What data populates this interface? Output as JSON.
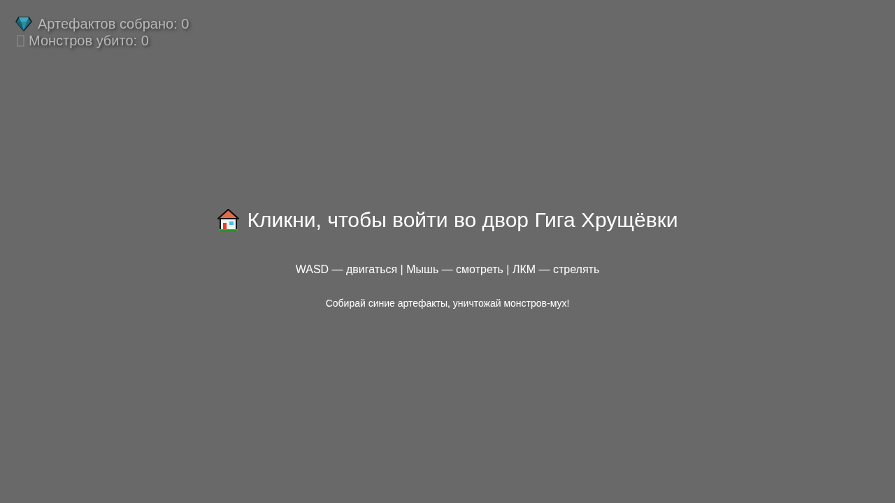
{
  "hud": {
    "stats": [
      {
        "kind": "artifacts",
        "text": "Артефактов собрано: 0"
      },
      {
        "kind": "monsters",
        "text": "Монстров убито: 0"
      }
    ]
  },
  "start_screen": {
    "title": "Кликни, чтобы войти во двор Гига Хрущёвки",
    "controls": "WASD — двигаться | Мышь — смотреть | ЛКМ — стрелять",
    "hint": "Собирай синие артефакты, уничтожай монстров-мух!"
  }
}
